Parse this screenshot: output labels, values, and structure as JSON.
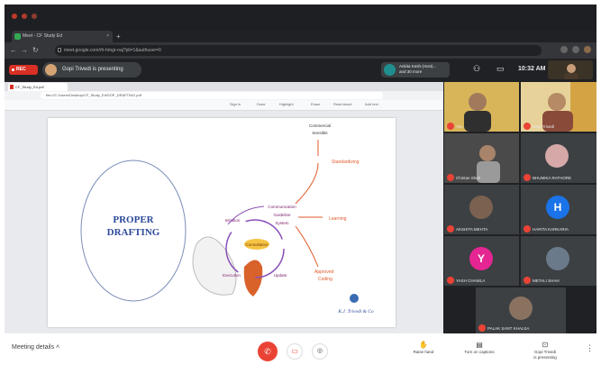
{
  "browser": {
    "tab_title": "Meet - CF Study Ed",
    "url": "meet.google.com/rfr-hmgr-oaj?pli=1&authuser=0"
  },
  "meet": {
    "rec_label": "REC",
    "presenter_text": "Gopi Trivedi is presenting",
    "guests_line1": "Ankita Kesh (Host)...",
    "guests_line2": "and 30 more",
    "time": "10:32 AM"
  },
  "shared_screen": {
    "pdf_tab": "CF_Study_Ed.pdf",
    "pdf_url": "file:///C:/Users/Desktop/CF_Study_Ed/SOP_DRAFTING.pdf",
    "toolbar": [
      "Sign in",
      "Draw",
      "Highlight",
      "Erase",
      "Read aloud",
      "Add text"
    ],
    "diagram": {
      "circle_title_line1": "PROPER",
      "circle_title_line2": "DRAFTING",
      "top_note_line1": "Commercial",
      "top_note_line2": "Sensible",
      "center": "Consultation",
      "left_node": "Initiation",
      "mid_node_line1": "Communication",
      "mid_node_line2": "Guideline",
      "mid_node_line3": "System",
      "bottom_left": "Execution",
      "bottom_right": "Update",
      "out1": "Standardizing",
      "out2": "Learning",
      "out3_line1": "Approved",
      "out3_line2": "Coding",
      "firm": "K.J. Trivedi & Co"
    }
  },
  "participants": [
    {
      "name": "You",
      "initial": "",
      "color": "#6b5a3a"
    },
    {
      "name": "Gopi Trivedi",
      "initial": "",
      "color": "#7a6a48"
    },
    {
      "name": "Chintan Shah",
      "initial": "",
      "color": "#5a5a5a"
    },
    {
      "name": "BHUMIKA RATHORE",
      "initial": "",
      "color": "#c58a8a"
    },
    {
      "name": "AKSHITA MEHTA",
      "initial": "",
      "color": "#6f5b4a"
    },
    {
      "name": "HARITA KARKARIA",
      "initial": "H",
      "color": "#1a73e8"
    },
    {
      "name": "YASH CHAWLA",
      "initial": "Y",
      "color": "#e52592"
    },
    {
      "name": "METALI SHAH",
      "initial": "",
      "color": "#5a6b7a"
    },
    {
      "name": "PALAK SANT KHALSA",
      "initial": "",
      "color": "#8a7260"
    }
  ],
  "bottom_bar": {
    "meeting_details": "Meeting details",
    "raise_hand": "Raise hand",
    "captions": "Turn on captions",
    "presenting_line1": "Gopi Trivedi",
    "presenting_line2": "is presenting"
  }
}
